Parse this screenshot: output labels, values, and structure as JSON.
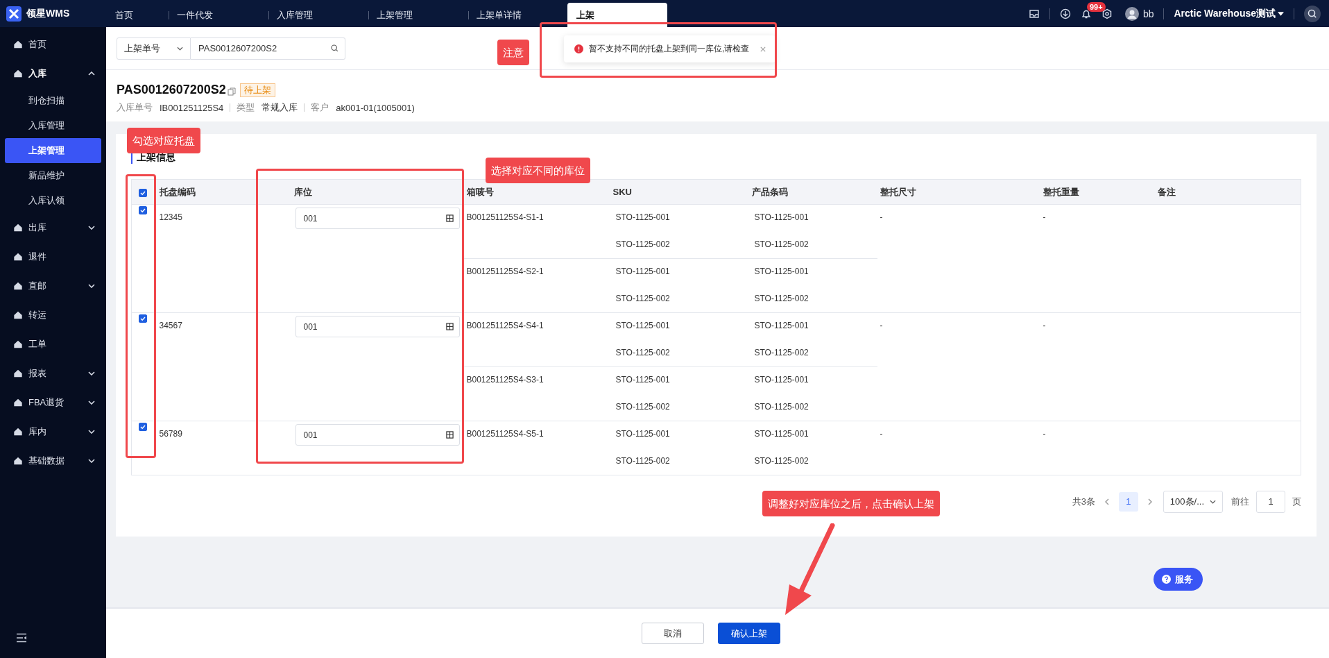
{
  "app": {
    "logo_text": "领星WMS"
  },
  "tabs": [
    {
      "label": "首页",
      "selected": false
    },
    {
      "label": "一件代发",
      "selected": false
    },
    {
      "label": "入库管理",
      "selected": false
    },
    {
      "label": "上架管理",
      "selected": false
    },
    {
      "label": "上架单详情",
      "selected": false
    },
    {
      "label": "上架",
      "selected": true
    }
  ],
  "header": {
    "notification_count": "99+",
    "user": "bb",
    "warehouse": "Arctic Warehouse测试"
  },
  "sidebar": {
    "items": [
      {
        "label": "首页",
        "selected": false
      },
      {
        "label": "入库",
        "selected": false,
        "expanded": true,
        "children": [
          {
            "label": "到仓扫描",
            "selected": false
          },
          {
            "label": "入库管理",
            "selected": false
          },
          {
            "label": "上架管理",
            "selected": true
          },
          {
            "label": "新品维护",
            "selected": false
          },
          {
            "label": "入库认领",
            "selected": false
          }
        ]
      },
      {
        "label": "出库",
        "selected": false,
        "expanded": false
      },
      {
        "label": "退件",
        "selected": false
      },
      {
        "label": "直邮",
        "selected": false,
        "expanded": false
      },
      {
        "label": "转运",
        "selected": false
      },
      {
        "label": "工单",
        "selected": false
      },
      {
        "label": "报表",
        "selected": false,
        "expanded": false
      },
      {
        "label": "FBA退货",
        "selected": false,
        "expanded": false
      },
      {
        "label": "库内",
        "selected": false,
        "expanded": false
      },
      {
        "label": "基础数据",
        "selected": false,
        "expanded": false
      }
    ]
  },
  "search": {
    "field": "上架单号",
    "value": "PAS0012607200S2"
  },
  "toast": {
    "message": "暂不支持不同的托盘上架到同一库位,请检查"
  },
  "order": {
    "number": "PAS0012607200S2",
    "status": "待上架",
    "meta": [
      {
        "label": "入库单号",
        "value": "IB001251125S4"
      },
      {
        "label": "类型",
        "value": "常规入库"
      },
      {
        "label": "客户",
        "value": "ak001-01(1005001)"
      }
    ]
  },
  "section_title": "上架信息",
  "table": {
    "all_checked": true,
    "columns": [
      "托盘编码",
      "库位",
      "箱唛号",
      "SKU",
      "产品条码",
      "整托尺寸",
      "整托重量",
      "备注"
    ],
    "pallets": [
      {
        "code": "12345",
        "checked": true,
        "location": "001",
        "size": "-",
        "weight": "-",
        "boxes": [
          {
            "mark": "B001251125S4-S1-1",
            "items": [
              {
                "sku": "STO-1125-001",
                "barcode": "STO-1125-001"
              },
              {
                "sku": "STO-1125-002",
                "barcode": "STO-1125-002"
              }
            ]
          },
          {
            "mark": "B001251125S4-S2-1",
            "items": [
              {
                "sku": "STO-1125-001",
                "barcode": "STO-1125-001"
              },
              {
                "sku": "STO-1125-002",
                "barcode": "STO-1125-002"
              }
            ]
          }
        ]
      },
      {
        "code": "34567",
        "checked": true,
        "location": "001",
        "size": "-",
        "weight": "-",
        "boxes": [
          {
            "mark": "B001251125S4-S4-1",
            "items": [
              {
                "sku": "STO-1125-001",
                "barcode": "STO-1125-001"
              },
              {
                "sku": "STO-1125-002",
                "barcode": "STO-1125-002"
              }
            ]
          },
          {
            "mark": "B001251125S4-S3-1",
            "items": [
              {
                "sku": "STO-1125-001",
                "barcode": "STO-1125-001"
              },
              {
                "sku": "STO-1125-002",
                "barcode": "STO-1125-002"
              }
            ]
          }
        ]
      },
      {
        "code": "56789",
        "checked": true,
        "location": "001",
        "size": "-",
        "weight": "-",
        "boxes": [
          {
            "mark": "B001251125S4-S5-1",
            "items": [
              {
                "sku": "STO-1125-001",
                "barcode": "STO-1125-001"
              },
              {
                "sku": "STO-1125-002",
                "barcode": "STO-1125-002"
              }
            ]
          }
        ]
      }
    ]
  },
  "pagination": {
    "total": "共3条",
    "pages": [
      {
        "label": "1",
        "selected": true
      }
    ],
    "page_size": "100条/...",
    "goto_label": "前往",
    "goto_value": "1",
    "page_unit": "页"
  },
  "service_button": "服务",
  "buttons": [
    {
      "label": "取消",
      "kind": "default"
    },
    {
      "label": "确认上架",
      "kind": "primary"
    }
  ],
  "annotations": [
    {
      "text": "注意"
    },
    {
      "text": "勾选对应托盘"
    },
    {
      "text": "选择对应不同的库位"
    },
    {
      "text": "调整好对应库位之后，点击确认上架"
    }
  ]
}
